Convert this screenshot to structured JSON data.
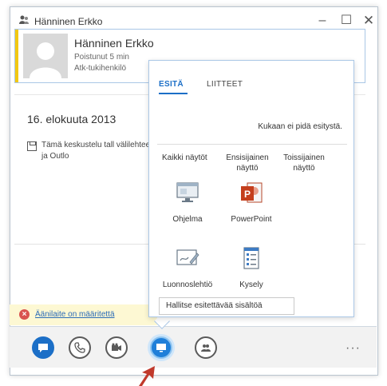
{
  "window": {
    "title": "Hänninen Erkko",
    "min": "–",
    "max": "☐",
    "close": "✕"
  },
  "contact": {
    "name": "Hänninen Erkko",
    "status": "Poistunut 5 min",
    "role": "Atk-tukihenkilö"
  },
  "conversation": {
    "date": "16. elokuuta 2013",
    "save_note": "Tämä keskustelu tall välilehteen ja Outlo"
  },
  "notification": {
    "text": "Äänilaite on määritettä"
  },
  "present_menu": {
    "tabs": [
      "ESITÄ",
      "LIITTEET"
    ],
    "nobody_presenting": "Kukaan ei pidä esitystä.",
    "options": {
      "all": "Kaikki näytöt",
      "primary": "Ensisijainen näyttö",
      "secondary": "Toissijainen näyttö"
    },
    "items": {
      "program": "Ohjelma",
      "powerpoint": "PowerPoint",
      "whiteboard": "Luonnoslehtiö",
      "poll": "Kysely"
    },
    "manage": "Hallitse esitettävää sisältöä"
  },
  "toolbar": {
    "more": "···"
  },
  "colors": {
    "accent": "#1c6fc7",
    "presence_away": "#f2c811",
    "notification_bg": "#fdf8d3",
    "arrow": "#c0392b"
  }
}
